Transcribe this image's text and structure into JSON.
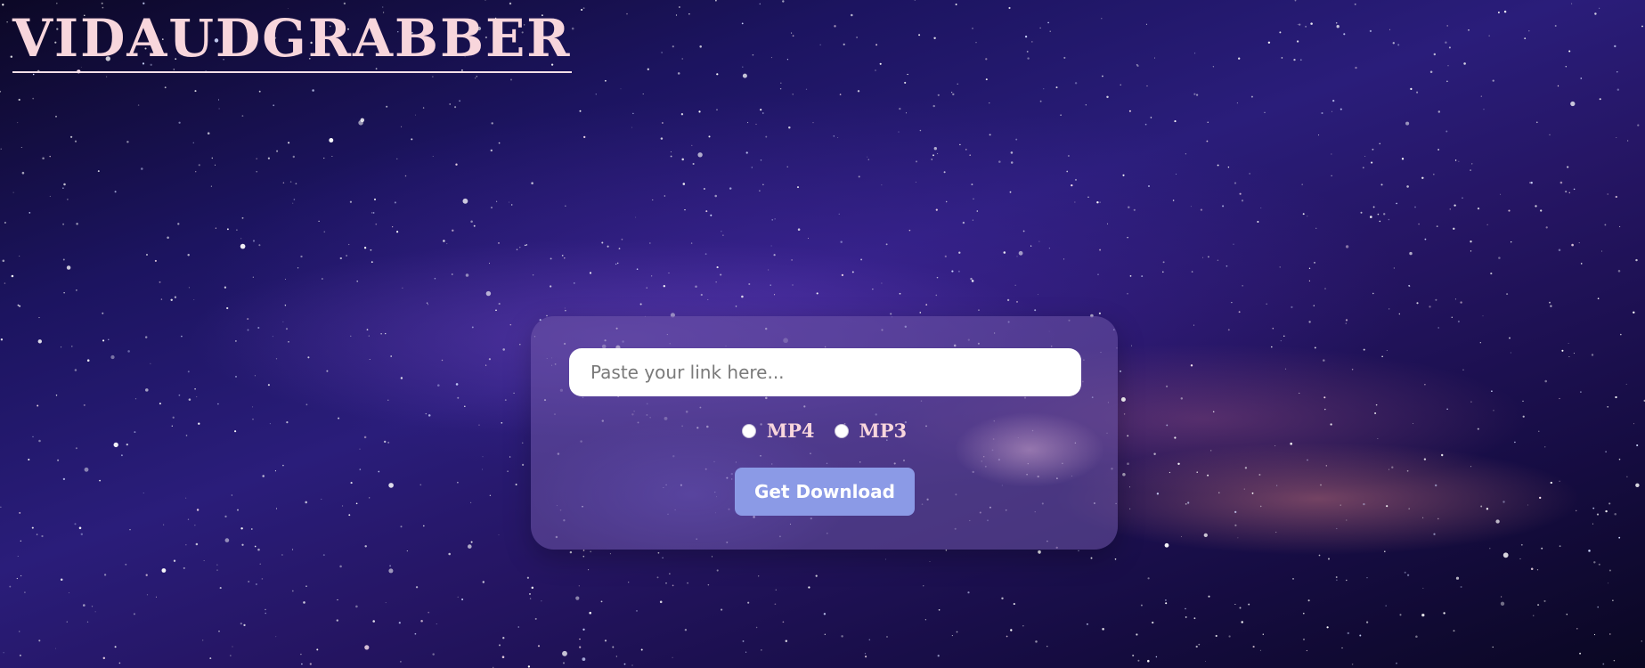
{
  "brand": {
    "title": "VIDAUDGRABBER"
  },
  "form": {
    "link_placeholder": "Paste your link here...",
    "link_value": "",
    "formats": [
      {
        "label": "MP4",
        "selected": false
      },
      {
        "label": "MP3",
        "selected": false
      }
    ],
    "submit_label": "Get Download"
  },
  "colors": {
    "brand_text": "#f8d6dc",
    "button_bg": "#8b9ae6",
    "card_bg": "#6e55a5"
  },
  "background": {
    "description_icon": "starry-night-sky"
  }
}
